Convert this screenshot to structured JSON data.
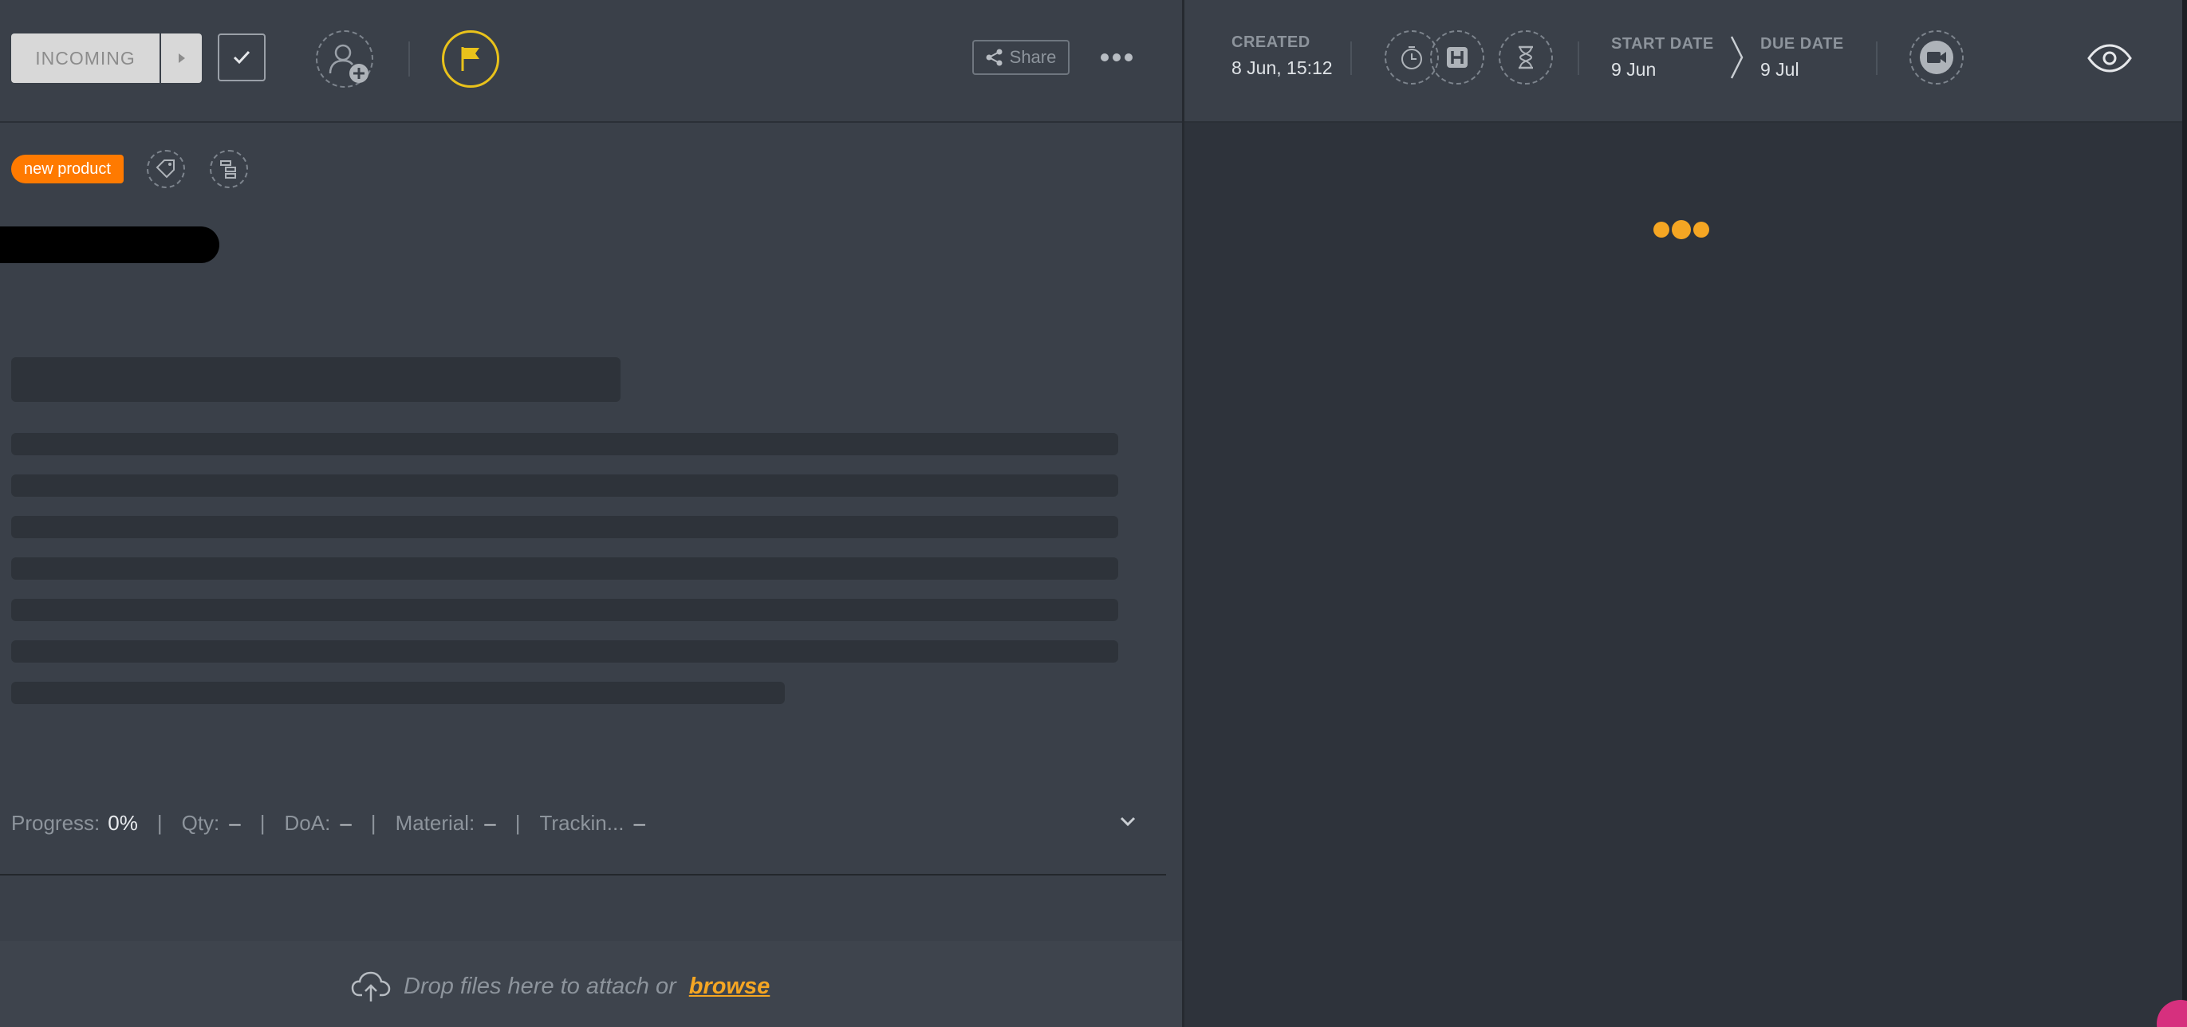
{
  "toolbar": {
    "status_label": "INCOMING",
    "share_label": "Share",
    "flag_color": "#e9c21b"
  },
  "tags": {
    "items": [
      {
        "label": "new product",
        "color": "#ff7a00"
      }
    ]
  },
  "fields": {
    "progress_label": "Progress:",
    "progress_value": "0%",
    "qty_label": "Qty:",
    "qty_value": "–",
    "doa_label": "DoA:",
    "doa_value": "–",
    "material_label": "Material:",
    "material_value": "–",
    "tracking_label": "Trackin...",
    "tracking_value": "–",
    "separator": "|"
  },
  "dropzone": {
    "text": "Drop files here to attach or",
    "link": "browse"
  },
  "details": {
    "created_label": "CREATED",
    "created_value": "8 Jun, 15:12",
    "start_label": "START DATE",
    "start_value": "9 Jun",
    "due_label": "DUE DATE",
    "due_value": "9 Jul"
  },
  "icons": [
    "chevron-right-icon",
    "check-icon",
    "add-user-icon",
    "flag-icon",
    "share-icon",
    "more-icon",
    "tag-icon",
    "hierarchy-icon",
    "timer-icon",
    "hours-icon",
    "hourglass-icon",
    "video-icon",
    "eye-icon",
    "upload-cloud-icon",
    "chevron-down-icon"
  ],
  "colors": {
    "accent": "#f5a623",
    "tag": "#ff7a00",
    "background": "#3a4049"
  }
}
